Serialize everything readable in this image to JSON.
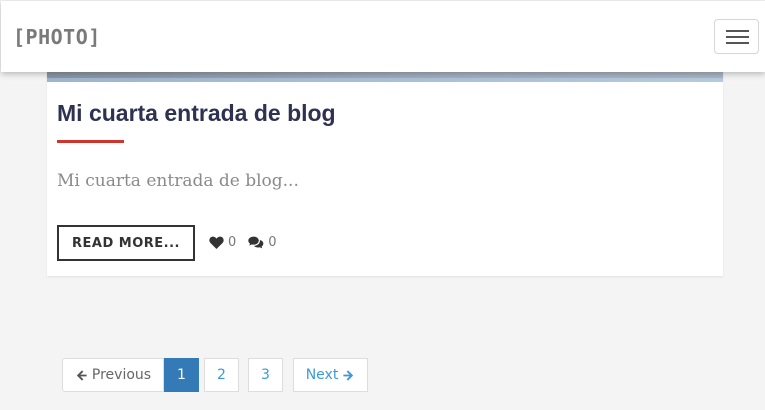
{
  "navbar": {
    "brand": "[PHOTO]",
    "menu_icon": "hamburger-menu-icon"
  },
  "post": {
    "title": "Mi cuarta entrada de blog",
    "excerpt": "Mi cuarta entrada de blog...",
    "read_more_label": "READ MORE...",
    "likes_count": "0",
    "likes_icon": "heart-icon",
    "comments_count": "0",
    "comments_icon": "comments-icon"
  },
  "pagination": {
    "previous_label": "Previous",
    "previous_icon": "arrow-left-icon",
    "pages": [
      "1",
      "2",
      "3"
    ],
    "current_page": "1",
    "next_label": "Next",
    "next_icon": "arrow-right-icon"
  },
  "colors": {
    "accent": "#d0342c",
    "title": "#2d3250",
    "link": "#3a9ad9",
    "active_page": "#337ab7"
  }
}
